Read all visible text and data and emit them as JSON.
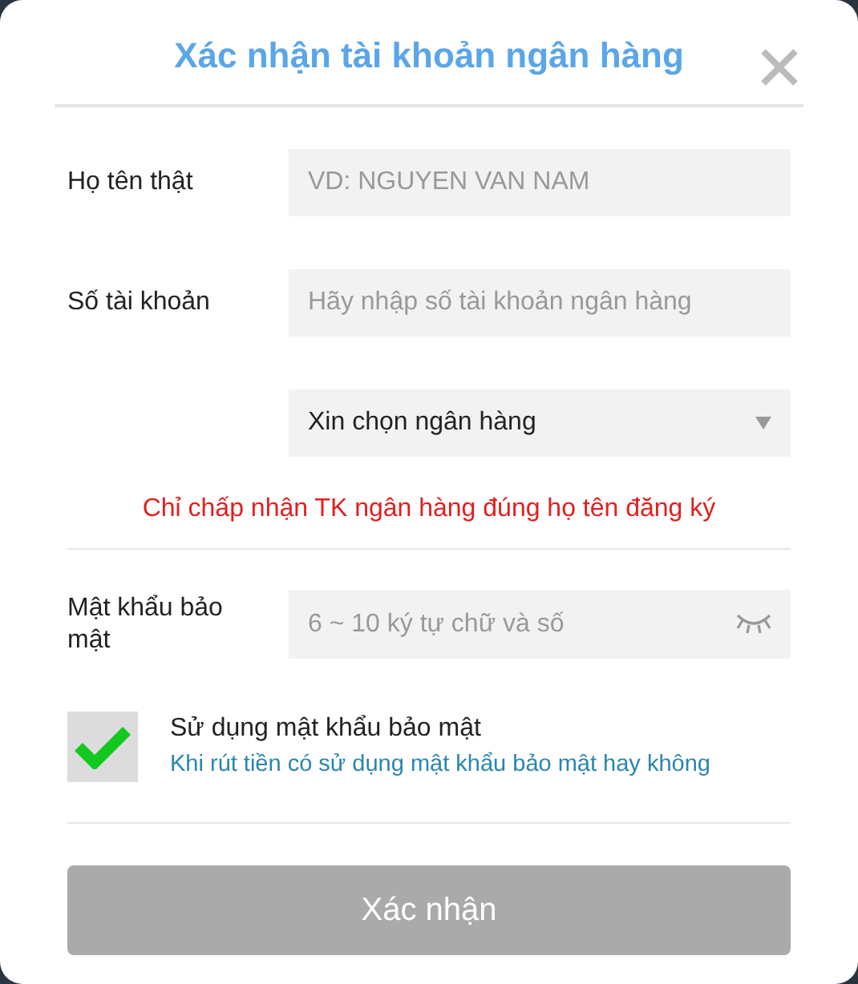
{
  "dialog": {
    "title": "Xác nhận tài khoản ngân hàng"
  },
  "fields": [
    {
      "kind": "text",
      "label": "Họ tên thật",
      "placeholder": "VD: NGUYEN VAN NAM"
    },
    {
      "kind": "text",
      "label": "Số tài khoản",
      "placeholder": "Hãy nhập số tài khoản ngân hàng"
    },
    {
      "kind": "select",
      "value": "Xin chọn ngân hàng"
    }
  ],
  "notice": "Chỉ chấp nhận TK ngân hàng đúng họ tên đăng ký",
  "password": {
    "label": "Mật khẩu bảo mật",
    "placeholder": "6 ~ 10 ký tự chữ và số"
  },
  "option": {
    "checked": true,
    "label": "Sử dụng mật khẩu bảo mật",
    "hint": "Khi rút tiền có sử dụng mật khẩu bảo mật hay không"
  },
  "submit": {
    "label": "Xác nhận",
    "disabled": true
  }
}
